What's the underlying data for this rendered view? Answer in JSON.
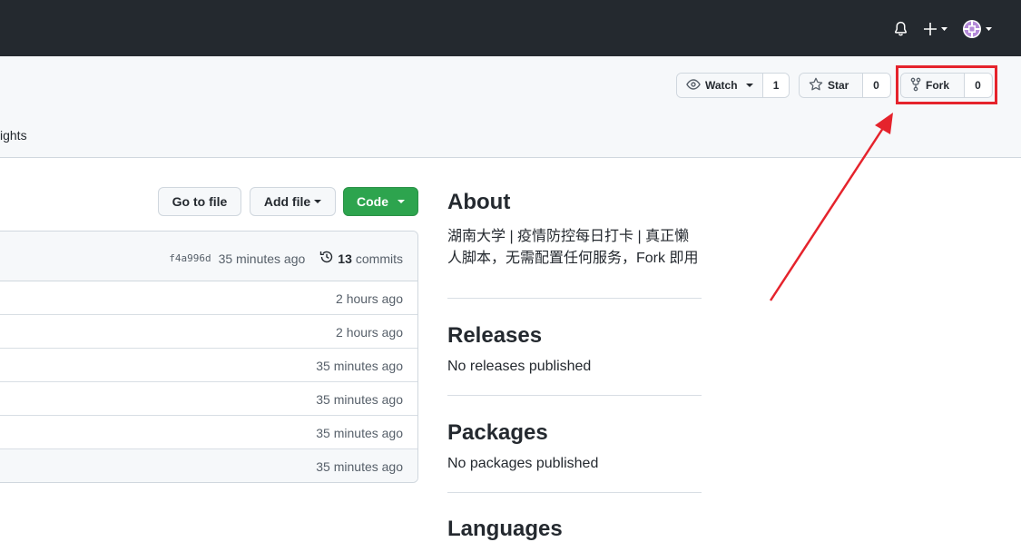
{
  "header": {
    "avatar_color": "#b48ad8"
  },
  "repo_actions": {
    "watch": {
      "label": "Watch",
      "count": "1"
    },
    "star": {
      "label": "Star",
      "count": "0"
    },
    "fork": {
      "label": "Fork",
      "count": "0"
    }
  },
  "tabs": {
    "partial_label": "ights"
  },
  "file_toolbar": {
    "go_to_file": "Go to file",
    "add_file": "Add file",
    "code": "Code"
  },
  "latest_commit": {
    "sha": "f4a996d",
    "time": "35 minutes ago",
    "commits_count": "13",
    "commits_label": "commits"
  },
  "file_rows": [
    {
      "age": "2 hours ago"
    },
    {
      "age": "2 hours ago"
    },
    {
      "age": "35 minutes ago"
    },
    {
      "age": "35 minutes ago"
    },
    {
      "age": "35 minutes ago"
    },
    {
      "age": "35 minutes ago"
    }
  ],
  "about": {
    "title": "About",
    "description_line1": "湖南大学 | 疫情防控每日打卡 | 真正懒",
    "description_line2": "人脚本，无需配置任何服务，Fork 即用"
  },
  "releases": {
    "title": "Releases",
    "text": "No releases published"
  },
  "packages": {
    "title": "Packages",
    "text": "No packages published"
  },
  "languages": {
    "title": "Languages"
  },
  "annotation": {
    "color": "#e5232c"
  }
}
